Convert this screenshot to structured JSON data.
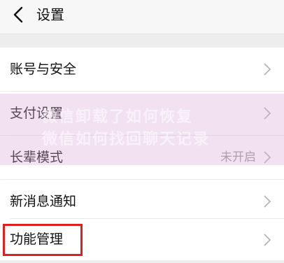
{
  "header": {
    "title": "设置"
  },
  "rows": [
    {
      "label": "账号与安全",
      "value": ""
    },
    {
      "label": "支付设置",
      "value": ""
    },
    {
      "label": "长辈模式",
      "value": "未开启"
    },
    {
      "label": "新消息通知",
      "value": ""
    },
    {
      "label": "功能管理",
      "value": ""
    }
  ],
  "watermark": {
    "lines": [
      "微信卸载了如何恢复",
      "微信如何找回聊天记录"
    ]
  },
  "colors": {
    "highlight_border": "#e02020",
    "watermark_tint": "#d6aad6"
  }
}
